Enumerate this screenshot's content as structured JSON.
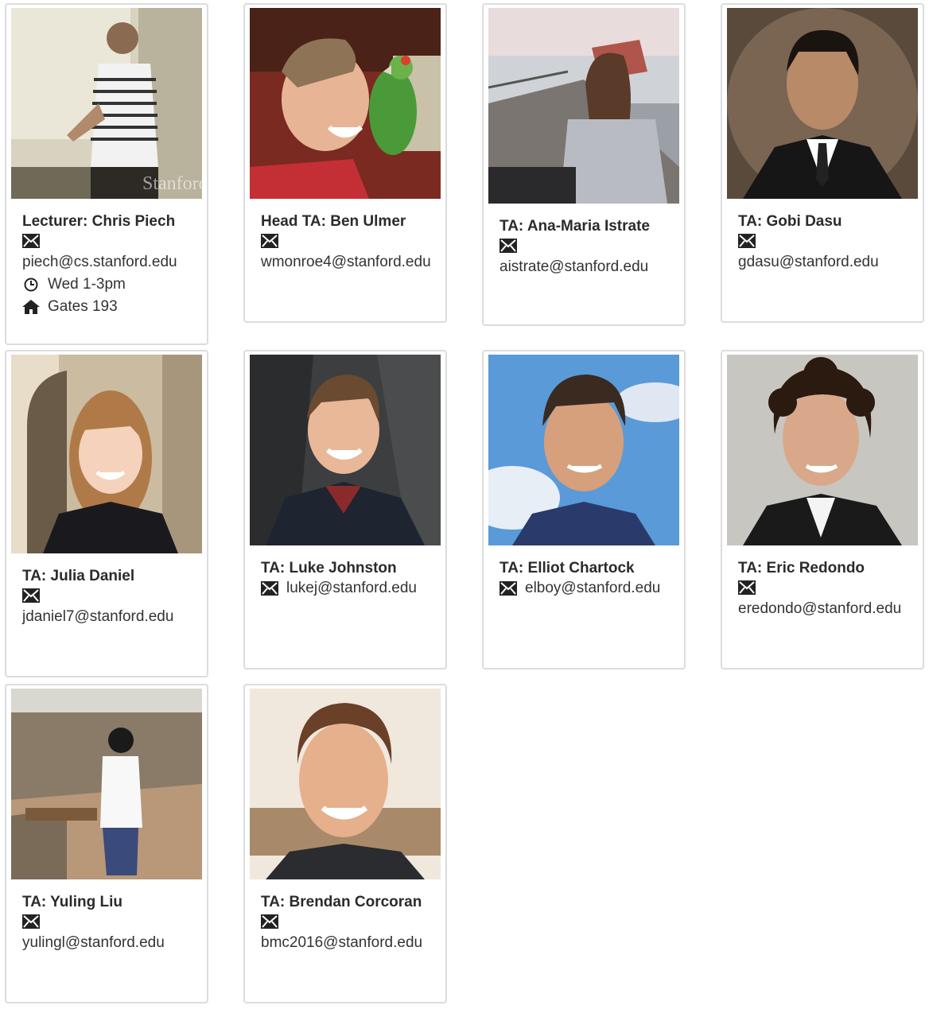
{
  "staff": [
    {
      "title": "Lecturer: Chris Piech",
      "email": "piech@cs.stanford.edu",
      "hours": "Wed 1-3pm",
      "office": "Gates 193",
      "photo_icon": "person-photo"
    },
    {
      "title": "Head TA: Ben Ulmer",
      "email": "wmonroe4@stanford.edu",
      "photo_icon": "person-photo"
    },
    {
      "title": "TA: Ana-Maria Istrate",
      "email": "aistrate@stanford.edu",
      "photo_icon": "person-photo"
    },
    {
      "title": "TA: Gobi Dasu",
      "email": "gdasu@stanford.edu",
      "photo_icon": "person-photo"
    },
    {
      "title": "TA: Julia Daniel",
      "email": "jdaniel7@stanford.edu",
      "photo_icon": "person-photo"
    },
    {
      "title": "TA: Luke Johnston",
      "email": "lukej@stanford.edu",
      "photo_icon": "person-photo"
    },
    {
      "title": "TA: Elliot Chartock",
      "email": "elboy@stanford.edu",
      "photo_icon": "person-photo"
    },
    {
      "title": "TA: Eric Redondo",
      "email": "eredondo@stanford.edu",
      "photo_icon": "person-photo"
    },
    {
      "title": "TA: Yuling Liu",
      "email": "yulingl@stanford.edu",
      "photo_icon": "person-photo"
    },
    {
      "title": "TA: Brendan Corcoran",
      "email": "bmc2016@stanford.edu",
      "photo_icon": "person-photo"
    }
  ],
  "photo_caption": "Stanford",
  "icons": {
    "email": "envelope-icon",
    "hours": "clock-icon",
    "office": "home-icon"
  },
  "colors": {
    "border": "#dcdcdc",
    "text": "#333333",
    "name": "#2b2b2b"
  }
}
